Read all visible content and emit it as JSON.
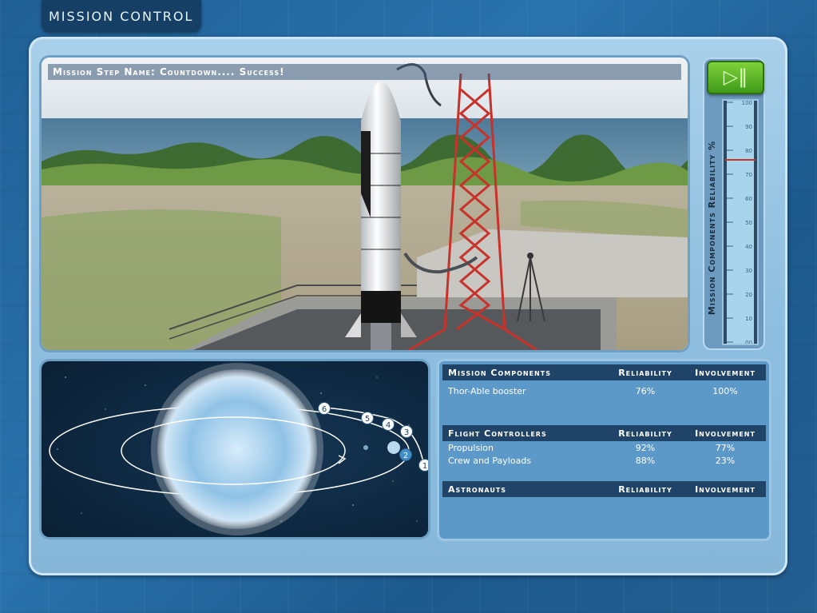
{
  "app": {
    "title": "Mission Control"
  },
  "video": {
    "caption": "Mission Step Name: Countdown.... Success!"
  },
  "controls": {
    "play_pause_icon": "play-pause-icon"
  },
  "gauge": {
    "label": "Mission Components Reliability %",
    "ticks": [
      "100",
      "90",
      "80",
      "70",
      "60",
      "50",
      "40",
      "30",
      "20",
      "10",
      "00"
    ],
    "value_percent": 76,
    "colors": {
      "fill": "#a8d4ec",
      "marker": "#c0392b"
    }
  },
  "orbit": {
    "steps": [
      "1",
      "2",
      "3",
      "4",
      "5",
      "6"
    ]
  },
  "mission_components": {
    "headers": {
      "name": "Mission Components",
      "reliability": "Reliability",
      "involvement": "Involvement"
    },
    "rows": [
      {
        "name": "Thor-Able booster",
        "reliability": "76%",
        "involvement": "100%"
      }
    ]
  },
  "flight_controllers": {
    "headers": {
      "name": "Flight Controllers",
      "reliability": "Reliability",
      "involvement": "Involvement"
    },
    "rows": [
      {
        "name": "Propulsion",
        "reliability": "92%",
        "involvement": "77%"
      },
      {
        "name": "Crew and Payloads",
        "reliability": "88%",
        "involvement": "23%"
      }
    ]
  },
  "astronauts": {
    "headers": {
      "name": "Astronauts",
      "reliability": "Reliability",
      "involvement": "Involvement"
    },
    "rows": []
  }
}
